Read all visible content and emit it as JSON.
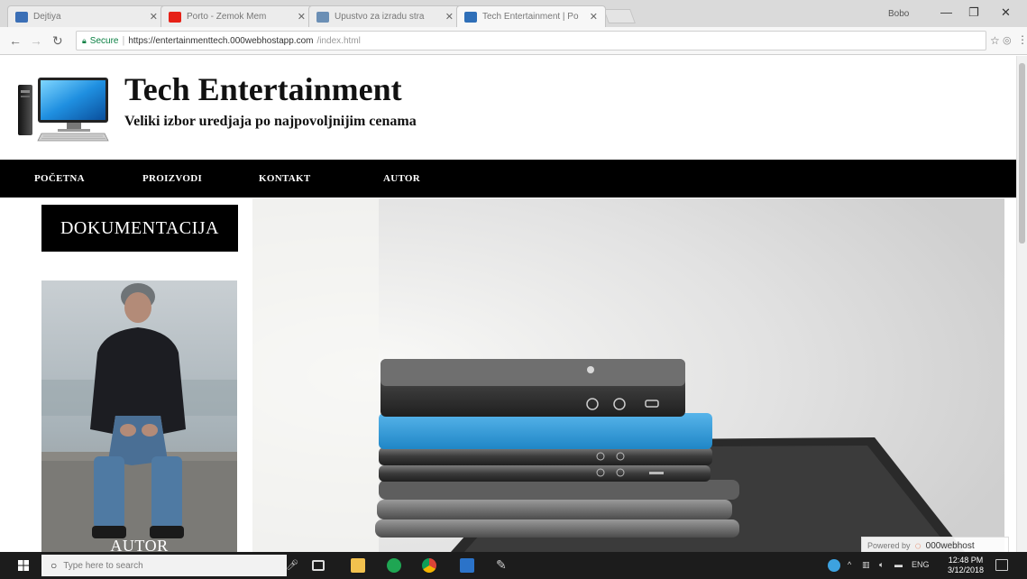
{
  "browser": {
    "tabs": [
      {
        "title": "Dejtiya",
        "favicon_color": "#3b6fb6",
        "active": false
      },
      {
        "title": "Porto - Zemok Mem",
        "favicon_color": "#e62117",
        "active": false
      },
      {
        "title": "Upustvo za izradu stra",
        "favicon_color": "#6b8fb5",
        "active": false
      },
      {
        "title": "Tech Entertainment | Po",
        "favicon_color": "#2f6fb8",
        "active": true
      }
    ],
    "profile": "Bobo",
    "secure_label": "Secure",
    "url_host": "https://entertainmenttech.000webhostapp.com",
    "url_path": "/index.html"
  },
  "site": {
    "title": "Tech Entertainment",
    "subtitle": "Veliki izbor uredjaja po najpovoljnijim cenama",
    "nav": [
      {
        "label": "POČETNA"
      },
      {
        "label": "PROIZVODI"
      },
      {
        "label": "KONTAKT"
      },
      {
        "label": "AUTOR"
      }
    ],
    "documentation_label": "DOKUMENTACIJA",
    "author_label": "AUTOR",
    "powered_by": "Powered by",
    "powered_brand": "000webhost"
  },
  "taskbar": {
    "search_placeholder": "Type here to search",
    "language": "ENG",
    "time": "12:48 PM",
    "date": "3/12/2018"
  },
  "colors": {
    "nav_bg": "#000000",
    "secure_green": "#0b8043",
    "taskbar_bg": "#1c1c1c"
  }
}
